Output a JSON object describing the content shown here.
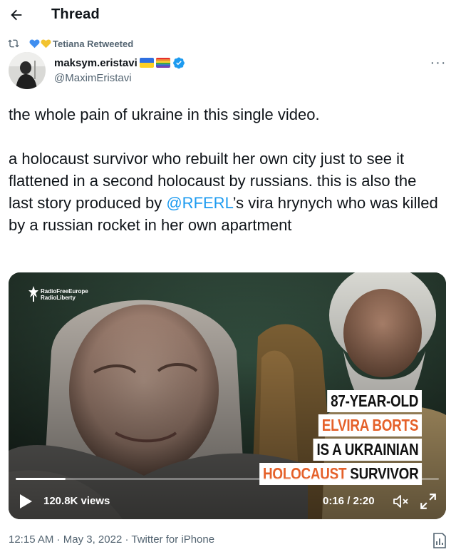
{
  "header": {
    "title": "Thread",
    "back_icon": "arrow-left-icon"
  },
  "retweet": {
    "label": "Tetiana Retweeted",
    "hearts": [
      "#3f8ef0",
      "#f2c32f"
    ]
  },
  "author": {
    "display_name": "maksym.eristavi",
    "handle": "@MaximEristavi",
    "flags": [
      "ukraine-flag",
      "rainbow-flag"
    ],
    "verified": true
  },
  "tweet": {
    "para1": "the whole pain of ukraine in this single video.",
    "para2_before": "a holocaust survivor who rebuilt her own city just to see it flattened in a second holocaust by russians. this is also the last story produced by ",
    "mention": "@RFERL",
    "para2_after": "’s vira hrynych who was killed by a russian rocket in her own apartment"
  },
  "video": {
    "logo_line1": "RadioFreeEurope",
    "logo_line2": "RadioLiberty",
    "caption": {
      "line1": "87-YEAR-OLD",
      "line2": "ELVIRA BORTS",
      "line3": "IS A UKRAINIAN",
      "line4_orange": "HOLOCAUST",
      "line4_black": " SURVIVOR"
    },
    "views": "120.8K views",
    "time": "0:16 / 2:20",
    "progress": 0.118
  },
  "meta": {
    "time": "12:15 AM",
    "sep1": " · ",
    "date": "May 3, 2022",
    "sep2": " · ",
    "source": "Twitter for iPhone"
  },
  "colors": {
    "accent": "#1d9bf0",
    "caption_orange": "#e5612a",
    "secondary_text": "#536471"
  }
}
